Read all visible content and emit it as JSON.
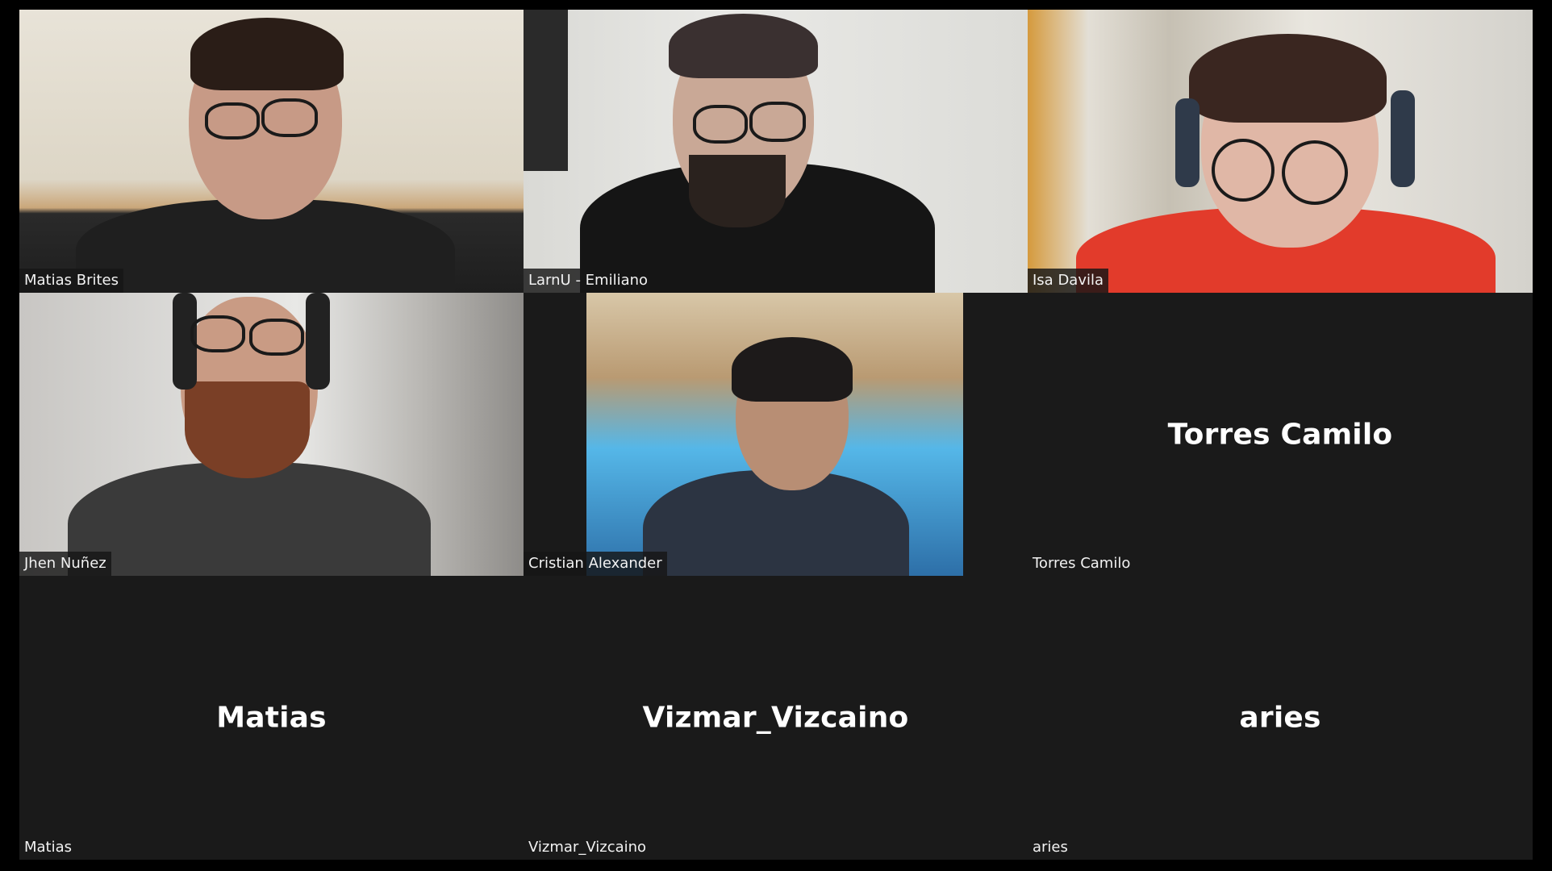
{
  "participants": [
    {
      "name": "Matias Brites",
      "video": true
    },
    {
      "name": "LarnU - Emiliano",
      "video": true
    },
    {
      "name": "Isa Davila",
      "video": true
    },
    {
      "name": "Jhen Nuñez",
      "video": true
    },
    {
      "name": "Cristian Alexander",
      "video": true
    },
    {
      "name": "Torres Camilo",
      "display_name": "Torres Camilo",
      "video": false
    },
    {
      "name": "Matias",
      "display_name": "Matias",
      "video": false
    },
    {
      "name": "Vizmar_Vizcaino",
      "display_name": "Vizmar_Vizcaino",
      "video": false
    },
    {
      "name": "aries",
      "display_name": "aries",
      "video": false
    }
  ],
  "colors": {
    "background": "#000000",
    "tile_empty": "#1a1a1a",
    "label_bg": "#161616",
    "label_text": "#f2f2f2",
    "center_name": "#ffffff"
  }
}
